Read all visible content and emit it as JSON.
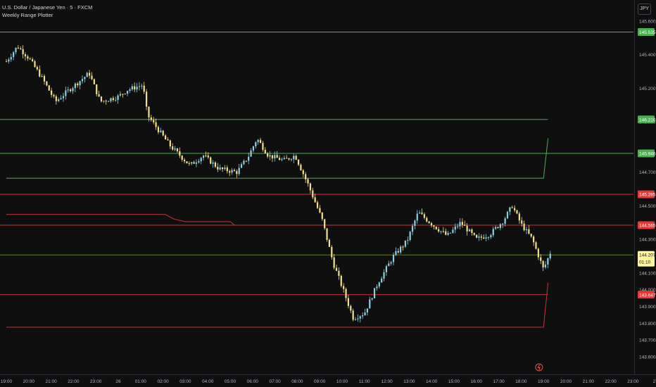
{
  "header": {
    "symbol_title": "U.S. Dollar / Japanese Yen · 5 · FXCM",
    "indicator_name": "Weekly Range Plotter",
    "currency_button": "JPY"
  },
  "colors": {
    "background": "#0f0f0f",
    "grid": "#1a1a1a",
    "up_candle": "#8fd0e0",
    "down_candle": "#f4e08a",
    "green_line": "#4caf50",
    "red_line": "#c8323c",
    "last_price_line": "#8bc34a",
    "last_price_badge": "#fff59d",
    "axis_text": "#b2b5be"
  },
  "chart_data": {
    "type": "candlestick",
    "title": "U.S. Dollar / Japanese Yen · 5 · FXCM",
    "y_axis": {
      "ticks": [
        "145.600",
        "145.400",
        "145.200",
        "145.000",
        "144.700",
        "144.500",
        "144.300",
        "144.100",
        "144.000",
        "143.900",
        "143.800",
        "143.700",
        "143.600"
      ],
      "tick_values": [
        145.6,
        145.4,
        145.2,
        145.0,
        144.7,
        144.5,
        144.3,
        144.1,
        144.0,
        143.9,
        143.8,
        143.7,
        143.6
      ],
      "ylim": [
        143.6,
        145.68
      ]
    },
    "x_axis": {
      "ticks": [
        "19:00",
        "20:00",
        "21:00",
        "22:00",
        "23:00",
        "26",
        "01:00",
        "02:00",
        "03:00",
        "04:00",
        "05:00",
        "06:00",
        "07:00",
        "08:00",
        "09:00",
        "10:00",
        "11:00",
        "12:00",
        "13:00",
        "14:00",
        "15:00",
        "16:00",
        "17:00",
        "18:00",
        "19:00",
        "20:00",
        "21:00",
        "22:00",
        "23:00",
        "27",
        "01:"
      ],
      "xlim": [
        0,
        30.1
      ]
    },
    "price_path": [
      [
        0.0,
        145.36
      ],
      [
        0.5,
        145.45
      ],
      [
        1.0,
        145.38
      ],
      [
        1.6,
        145.26
      ],
      [
        2.2,
        145.12
      ],
      [
        2.8,
        145.19
      ],
      [
        3.7,
        145.29
      ],
      [
        4.2,
        145.12
      ],
      [
        5.0,
        145.15
      ],
      [
        5.4,
        145.19
      ],
      [
        6.1,
        145.22
      ],
      [
        6.3,
        145.04
      ],
      [
        6.8,
        144.95
      ],
      [
        7.3,
        144.86
      ],
      [
        8.2,
        144.74
      ],
      [
        8.8,
        144.8
      ],
      [
        9.5,
        144.72
      ],
      [
        10.3,
        144.7
      ],
      [
        10.8,
        144.79
      ],
      [
        11.2,
        144.9
      ],
      [
        11.7,
        144.8
      ],
      [
        12.4,
        144.77
      ],
      [
        12.9,
        144.8
      ],
      [
        13.5,
        144.62
      ],
      [
        14.1,
        144.42
      ],
      [
        14.6,
        144.16
      ],
      [
        15.1,
        143.98
      ],
      [
        15.5,
        143.83
      ],
      [
        16.0,
        143.86
      ],
      [
        16.6,
        144.04
      ],
      [
        17.3,
        144.2
      ],
      [
        17.9,
        144.29
      ],
      [
        18.4,
        144.46
      ],
      [
        19.1,
        144.38
      ],
      [
        19.7,
        144.32
      ],
      [
        20.3,
        144.4
      ],
      [
        21.0,
        144.3
      ],
      [
        21.6,
        144.33
      ],
      [
        22.2,
        144.41
      ],
      [
        22.6,
        144.5
      ],
      [
        23.0,
        144.39
      ],
      [
        23.5,
        144.3
      ],
      [
        24.0,
        144.12
      ],
      [
        24.3,
        144.22
      ]
    ],
    "lines": [
      {
        "label": "145.535",
        "value": 145.535,
        "color": "#4caf50"
      },
      {
        "label": "146.210",
        "value": 145.014,
        "color": "#4caf50"
      },
      {
        "label": "145.946",
        "value": 144.812,
        "color": "#4caf50"
      },
      {
        "label": "145.285",
        "value": 144.568,
        "color": "#c8323c"
      },
      {
        "label": "144.565",
        "value": 144.384,
        "color": "#c8323c"
      },
      {
        "label": "143.647",
        "value": 143.97,
        "color": "#c8323c"
      }
    ],
    "step_lines": [
      {
        "color": "#4caf50",
        "points": [
          [
            0,
            144.664
          ],
          [
            24.0,
            144.664
          ],
          [
            24.2,
            144.902
          ]
        ]
      },
      {
        "color": "#c8323c",
        "points": [
          [
            0,
            144.448
          ],
          [
            7.1,
            144.448
          ],
          [
            7.5,
            144.42
          ],
          [
            8.0,
            144.405
          ],
          [
            10.0,
            144.405
          ],
          [
            10.2,
            144.384
          ],
          [
            24.0,
            144.384
          ]
        ]
      },
      {
        "color": "#c8323c",
        "points": [
          [
            0,
            143.776
          ],
          [
            24.0,
            143.776
          ],
          [
            24.2,
            144.04
          ]
        ]
      }
    ],
    "last_price": {
      "value": 144.207,
      "label": "144.207",
      "countdown": "01:10"
    },
    "grid": false,
    "legend": "top-left"
  }
}
